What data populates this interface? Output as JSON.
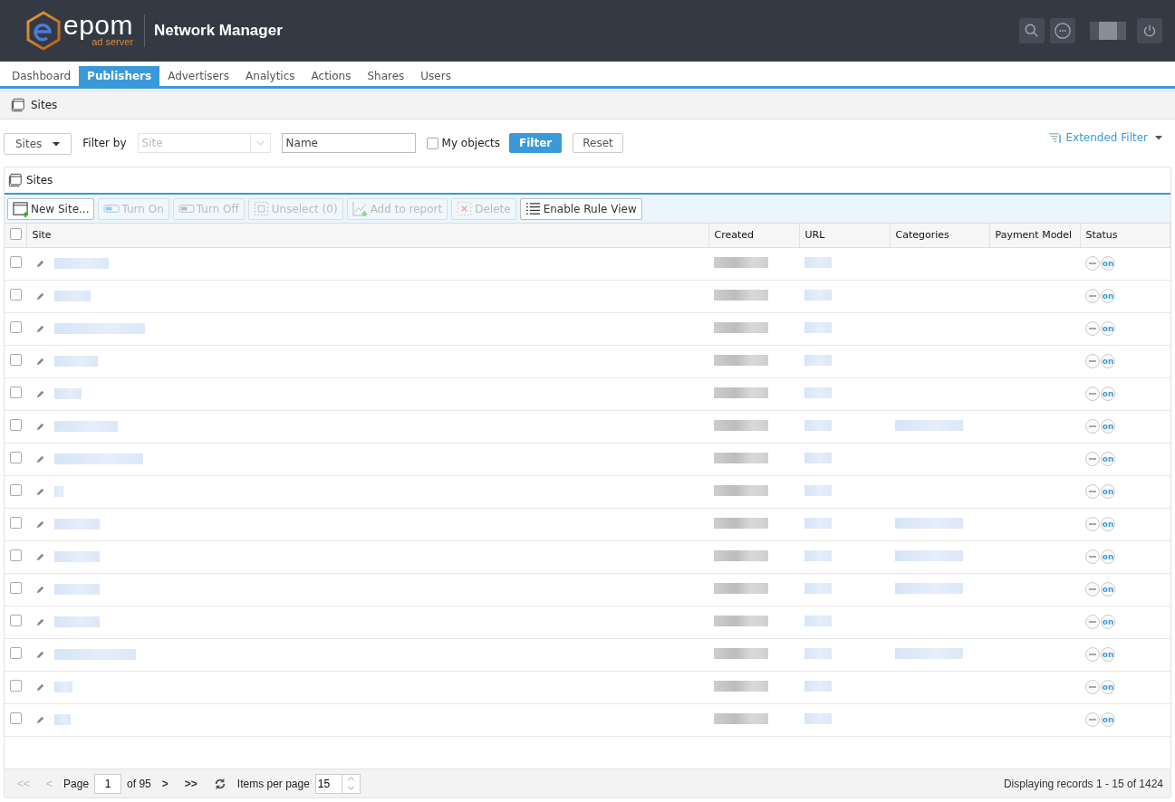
{
  "header": {
    "logo_word": "epom",
    "logo_sub": "ad server",
    "app_title": "Network Manager"
  },
  "tabs": [
    {
      "label": "Dashboard",
      "selected": false
    },
    {
      "label": "Publishers",
      "selected": true
    },
    {
      "label": "Advertisers",
      "selected": false
    },
    {
      "label": "Analytics",
      "selected": false
    },
    {
      "label": "Actions",
      "selected": false
    },
    {
      "label": "Shares",
      "selected": false
    },
    {
      "label": "Users",
      "selected": false
    }
  ],
  "breadcrumb": "Sites",
  "filter_bar": {
    "scope": "Sites",
    "filter_by": "Filter by",
    "select_placeholder": "Site",
    "name_placeholder": "Name",
    "my_objects": {
      "label": "My objects",
      "checked": false
    },
    "filter": "Filter",
    "reset": "Reset",
    "extended": "Extended Filter"
  },
  "panel": {
    "title": "Sites",
    "toolbar": [
      {
        "kind": "new",
        "label": "New Site...",
        "disabled": false
      },
      {
        "kind": "on",
        "label": "Turn On",
        "disabled": true
      },
      {
        "kind": "off",
        "label": "Turn Off",
        "disabled": true
      },
      {
        "kind": "unselect",
        "label": "Unselect (0)",
        "disabled": true
      },
      {
        "kind": "report",
        "label": "Add to report",
        "disabled": true
      },
      {
        "kind": "delete",
        "label": "Delete",
        "disabled": true
      },
      {
        "kind": "rules",
        "label": "Enable Rule View",
        "disabled": false
      }
    ],
    "table": {
      "columns": [
        "Site",
        "Created",
        "URL",
        "Categories",
        "Payment Model",
        "Status"
      ],
      "all_checked": false,
      "rows": [
        {
          "checked": false,
          "status": "on",
          "has_categories": false
        },
        {
          "checked": false,
          "status": "on",
          "has_categories": false
        },
        {
          "checked": false,
          "status": "on",
          "has_categories": false
        },
        {
          "checked": false,
          "status": "on",
          "has_categories": false
        },
        {
          "checked": false,
          "status": "on",
          "has_categories": false
        },
        {
          "checked": false,
          "status": "on",
          "has_categories": true
        },
        {
          "checked": false,
          "status": "on",
          "has_categories": false
        },
        {
          "checked": false,
          "status": "on",
          "has_categories": false
        },
        {
          "checked": false,
          "status": "on",
          "has_categories": true
        },
        {
          "checked": false,
          "status": "on",
          "has_categories": true
        },
        {
          "checked": false,
          "status": "on",
          "has_categories": true
        },
        {
          "checked": false,
          "status": "on",
          "has_categories": false
        },
        {
          "checked": false,
          "status": "on",
          "has_categories": true
        },
        {
          "checked": false,
          "status": "on",
          "has_categories": false
        },
        {
          "checked": false,
          "status": "on",
          "has_categories": false
        }
      ]
    },
    "pager": {
      "first": {
        "label": "<<",
        "disabled": true
      },
      "prev": {
        "label": "<",
        "disabled": true
      },
      "page_label": "Page",
      "page": "1",
      "of": "of 95",
      "next": {
        "label": ">",
        "disabled": false
      },
      "last": {
        "label": ">>",
        "disabled": false
      },
      "per_page_label": "Items per page",
      "per_page": "15",
      "summary": "Displaying records 1 - 15 of 1424"
    }
  }
}
